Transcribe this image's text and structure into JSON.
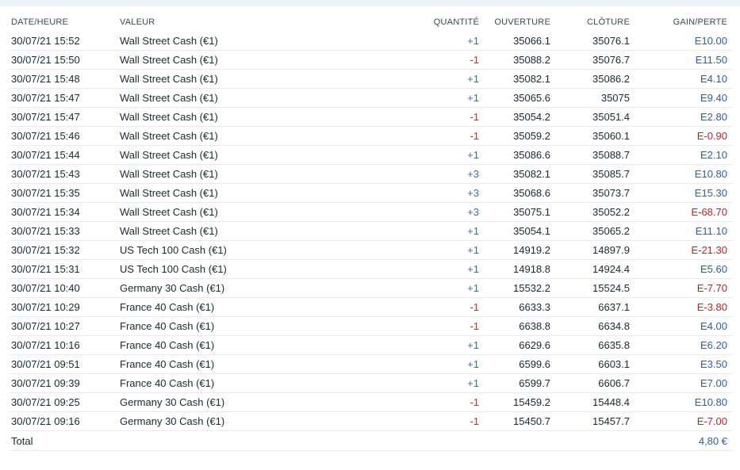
{
  "headers": {
    "date": "DATE/HEURE",
    "instrument": "VALEUR",
    "quantity": "QUANTITÉ",
    "open": "OUVERTURE",
    "close": "CLÔTURE",
    "pl": "GAIN/PERTE"
  },
  "rows": [
    {
      "date": "30/07/21 15:52",
      "instrument": "Wall Street Cash (€1)",
      "quantity": "+1",
      "open": "35066.1",
      "close": "35076.1",
      "pl": "E10.00",
      "qty_sign": "pos",
      "pl_sign": "pos"
    },
    {
      "date": "30/07/21 15:50",
      "instrument": "Wall Street Cash (€1)",
      "quantity": "-1",
      "open": "35088.2",
      "close": "35076.7",
      "pl": "E11.50",
      "qty_sign": "neg",
      "pl_sign": "pos"
    },
    {
      "date": "30/07/21 15:48",
      "instrument": "Wall Street Cash (€1)",
      "quantity": "+1",
      "open": "35082.1",
      "close": "35086.2",
      "pl": "E4.10",
      "qty_sign": "pos",
      "pl_sign": "pos"
    },
    {
      "date": "30/07/21 15:47",
      "instrument": "Wall Street Cash (€1)",
      "quantity": "+1",
      "open": "35065.6",
      "close": "35075",
      "pl": "E9.40",
      "qty_sign": "pos",
      "pl_sign": "pos"
    },
    {
      "date": "30/07/21 15:47",
      "instrument": "Wall Street Cash (€1)",
      "quantity": "-1",
      "open": "35054.2",
      "close": "35051.4",
      "pl": "E2.80",
      "qty_sign": "neg",
      "pl_sign": "pos"
    },
    {
      "date": "30/07/21 15:46",
      "instrument": "Wall Street Cash (€1)",
      "quantity": "-1",
      "open": "35059.2",
      "close": "35060.1",
      "pl": "E-0.90",
      "qty_sign": "neg",
      "pl_sign": "neg"
    },
    {
      "date": "30/07/21 15:44",
      "instrument": "Wall Street Cash (€1)",
      "quantity": "+1",
      "open": "35086.6",
      "close": "35088.7",
      "pl": "E2.10",
      "qty_sign": "pos",
      "pl_sign": "pos"
    },
    {
      "date": "30/07/21 15:43",
      "instrument": "Wall Street Cash (€1)",
      "quantity": "+3",
      "open": "35082.1",
      "close": "35085.7",
      "pl": "E10.80",
      "qty_sign": "pos",
      "pl_sign": "pos"
    },
    {
      "date": "30/07/21 15:35",
      "instrument": "Wall Street Cash (€1)",
      "quantity": "+3",
      "open": "35068.6",
      "close": "35073.7",
      "pl": "E15.30",
      "qty_sign": "pos",
      "pl_sign": "pos"
    },
    {
      "date": "30/07/21 15:34",
      "instrument": "Wall Street Cash (€1)",
      "quantity": "+3",
      "open": "35075.1",
      "close": "35052.2",
      "pl": "E-68.70",
      "qty_sign": "pos",
      "pl_sign": "neg"
    },
    {
      "date": "30/07/21 15:33",
      "instrument": "Wall Street Cash (€1)",
      "quantity": "+1",
      "open": "35054.1",
      "close": "35065.2",
      "pl": "E11.10",
      "qty_sign": "pos",
      "pl_sign": "pos"
    },
    {
      "date": "30/07/21 15:32",
      "instrument": "US Tech 100 Cash (€1)",
      "quantity": "+1",
      "open": "14919.2",
      "close": "14897.9",
      "pl": "E-21.30",
      "qty_sign": "pos",
      "pl_sign": "neg"
    },
    {
      "date": "30/07/21 15:31",
      "instrument": "US Tech 100 Cash (€1)",
      "quantity": "+1",
      "open": "14918.8",
      "close": "14924.4",
      "pl": "E5.60",
      "qty_sign": "pos",
      "pl_sign": "pos"
    },
    {
      "date": "30/07/21 10:40",
      "instrument": "Germany 30 Cash (€1)",
      "quantity": "+1",
      "open": "15532.2",
      "close": "15524.5",
      "pl": "E-7.70",
      "qty_sign": "pos",
      "pl_sign": "neg"
    },
    {
      "date": "30/07/21 10:29",
      "instrument": "France 40 Cash (€1)",
      "quantity": "-1",
      "open": "6633.3",
      "close": "6637.1",
      "pl": "E-3.80",
      "qty_sign": "neg",
      "pl_sign": "neg"
    },
    {
      "date": "30/07/21 10:27",
      "instrument": "France 40 Cash (€1)",
      "quantity": "-1",
      "open": "6638.8",
      "close": "6634.8",
      "pl": "E4.00",
      "qty_sign": "neg",
      "pl_sign": "pos"
    },
    {
      "date": "30/07/21 10:16",
      "instrument": "France 40 Cash (€1)",
      "quantity": "+1",
      "open": "6629.6",
      "close": "6635.8",
      "pl": "E6.20",
      "qty_sign": "pos",
      "pl_sign": "pos"
    },
    {
      "date": "30/07/21 09:51",
      "instrument": "France 40 Cash (€1)",
      "quantity": "+1",
      "open": "6599.6",
      "close": "6603.1",
      "pl": "E3.50",
      "qty_sign": "pos",
      "pl_sign": "pos"
    },
    {
      "date": "30/07/21 09:39",
      "instrument": "France 40 Cash (€1)",
      "quantity": "+1",
      "open": "6599.7",
      "close": "6606.7",
      "pl": "E7.00",
      "qty_sign": "pos",
      "pl_sign": "pos"
    },
    {
      "date": "30/07/21 09:25",
      "instrument": "Germany 30 Cash (€1)",
      "quantity": "-1",
      "open": "15459.2",
      "close": "15448.4",
      "pl": "E10.80",
      "qty_sign": "neg",
      "pl_sign": "pos"
    },
    {
      "date": "30/07/21 09:16",
      "instrument": "Germany 30 Cash (€1)",
      "quantity": "-1",
      "open": "15450.7",
      "close": "15457.7",
      "pl": "E-7.00",
      "qty_sign": "neg",
      "pl_sign": "neg"
    }
  ],
  "total": {
    "label": "Total",
    "value": "4,80 €"
  },
  "colors": {
    "positive": "#2f5f9a",
    "negative": "#b3262a"
  }
}
